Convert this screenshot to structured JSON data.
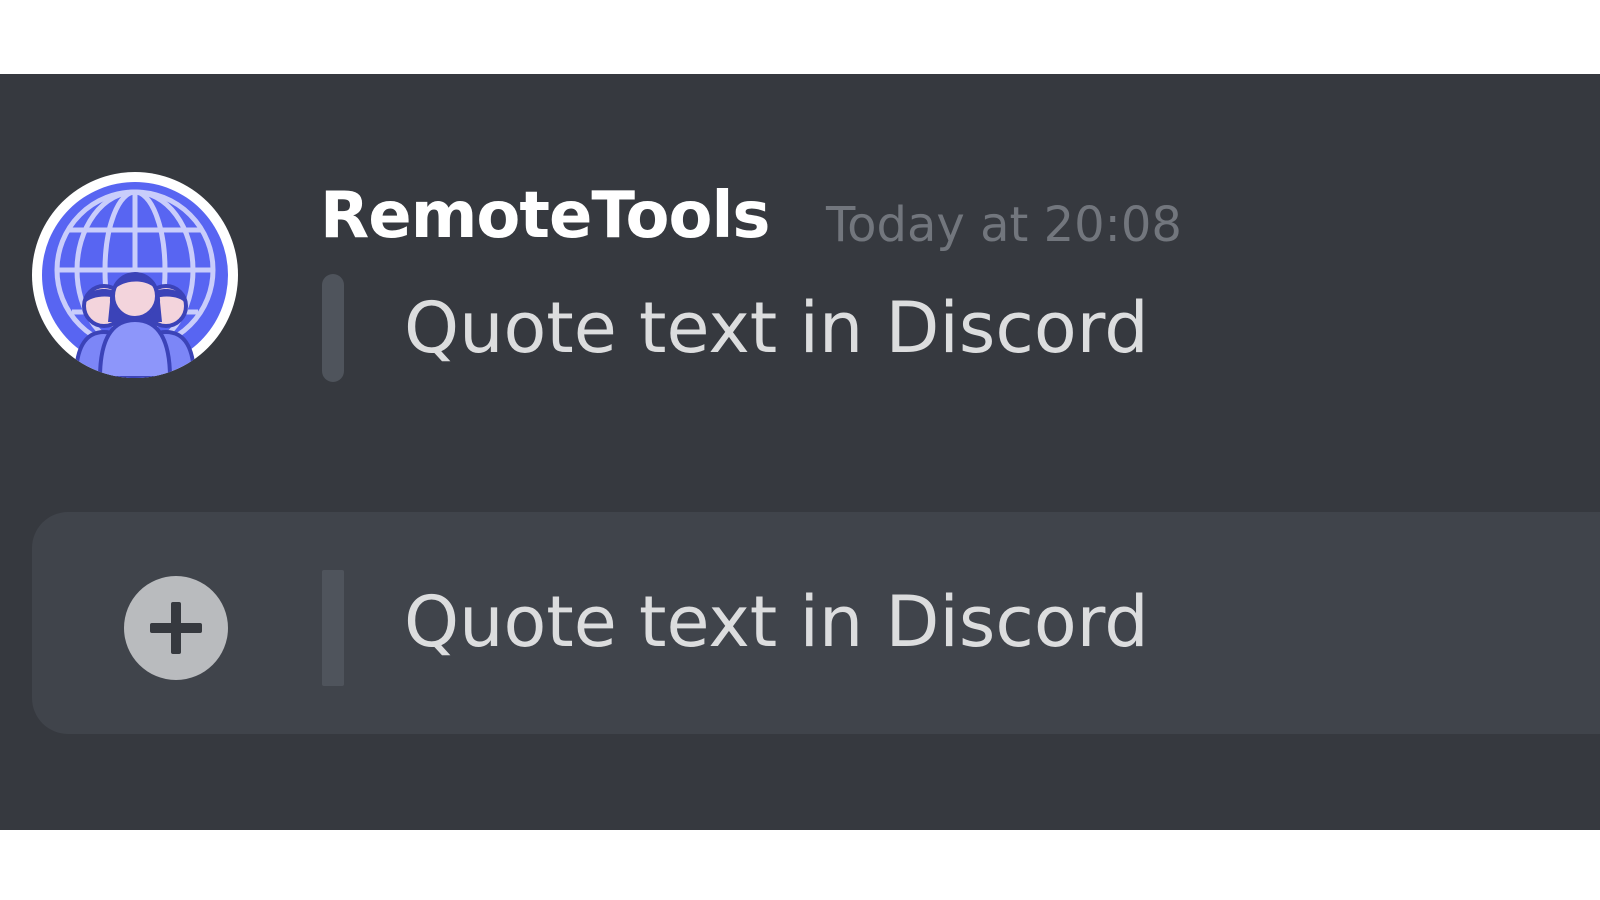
{
  "message": {
    "username": "RemoteTools",
    "timestamp": "Today at 20:08",
    "quote_text": "Quote text in Discord",
    "avatar_icon": "globe-team-avatar-icon"
  },
  "composer": {
    "attach_icon": "plus-circle-icon",
    "input_value": "Quote text in Discord"
  },
  "colors": {
    "background": "#36393f",
    "composer": "#40444b",
    "username": "#ffffff",
    "timestamp": "#72767d",
    "text": "#dcddde",
    "blockquote_bar": "#4f545c",
    "avatar_accent": "#5865f2"
  }
}
